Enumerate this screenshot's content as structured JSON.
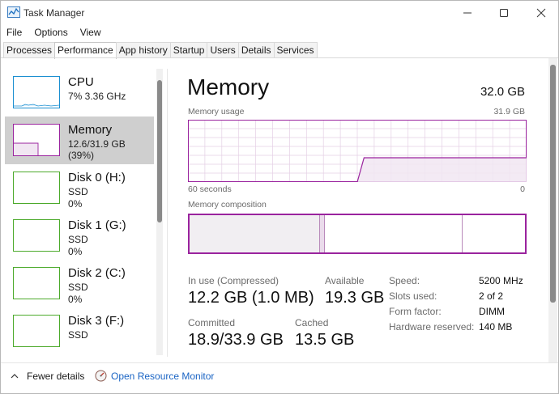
{
  "window": {
    "title": "Task Manager"
  },
  "menu": [
    "File",
    "Options",
    "View"
  ],
  "tabs": [
    "Processes",
    "Performance",
    "App history",
    "Startup",
    "Users",
    "Details",
    "Services"
  ],
  "sidebar": [
    {
      "name": "CPU",
      "sub1": "7%  3.36 GHz",
      "sub2": "",
      "color": "#1b8fd1",
      "usage": 0.07
    },
    {
      "name": "Memory",
      "sub1": "12.6/31.9 GB (39%)",
      "sub2": "",
      "color": "#9a239e",
      "usage": 0.39
    },
    {
      "name": "Disk 0 (H:)",
      "sub1": "SSD",
      "sub2": "0%",
      "color": "#4caa2b",
      "usage": 0
    },
    {
      "name": "Disk 1 (G:)",
      "sub1": "SSD",
      "sub2": "0%",
      "color": "#4caa2b",
      "usage": 0
    },
    {
      "name": "Disk 2 (C:)",
      "sub1": "SSD",
      "sub2": "0%",
      "color": "#4caa2b",
      "usage": 0
    },
    {
      "name": "Disk 3 (F:)",
      "sub1": "SSD",
      "sub2": "",
      "color": "#4caa2b",
      "usage": 0
    }
  ],
  "main": {
    "title": "Memory",
    "total": "32.0 GB",
    "usage_label": "Memory usage",
    "usage_max": "31.9 GB",
    "axis_left": "60 seconds",
    "axis_right": "0",
    "composition_label": "Memory composition"
  },
  "stats": {
    "in_use_label": "In use (Compressed)",
    "in_use_value": "12.2 GB (1.0 MB)",
    "available_label": "Available",
    "available_value": "19.3 GB",
    "committed_label": "Committed",
    "committed_value": "18.9/33.9 GB",
    "cached_label": "Cached",
    "cached_value": "13.5 GB"
  },
  "specs": [
    {
      "label": "Speed:",
      "value": "5200 MHz"
    },
    {
      "label": "Slots used:",
      "value": "2 of 2"
    },
    {
      "label": "Form factor:",
      "value": "DIMM"
    },
    {
      "label": "Hardware reserved:",
      "value": "140 MB"
    }
  ],
  "footer": {
    "fewer_details": "Fewer details",
    "open_resource_monitor": "Open Resource Monitor"
  },
  "chart_data": {
    "type": "area",
    "x_range_seconds": [
      60,
      0
    ],
    "y_range_gb": [
      0,
      31.9
    ],
    "series": [
      {
        "points_fraction": [
          [
            0,
            0
          ],
          [
            0.5,
            0
          ],
          [
            0.5,
            0
          ],
          [
            0.52,
            0.39
          ],
          [
            1,
            0.39
          ]
        ]
      }
    ],
    "composition": {
      "in_use": 0.39,
      "modified": 0.014,
      "standby": 0.41,
      "free": 0.186
    },
    "accent": "#9a239e"
  }
}
